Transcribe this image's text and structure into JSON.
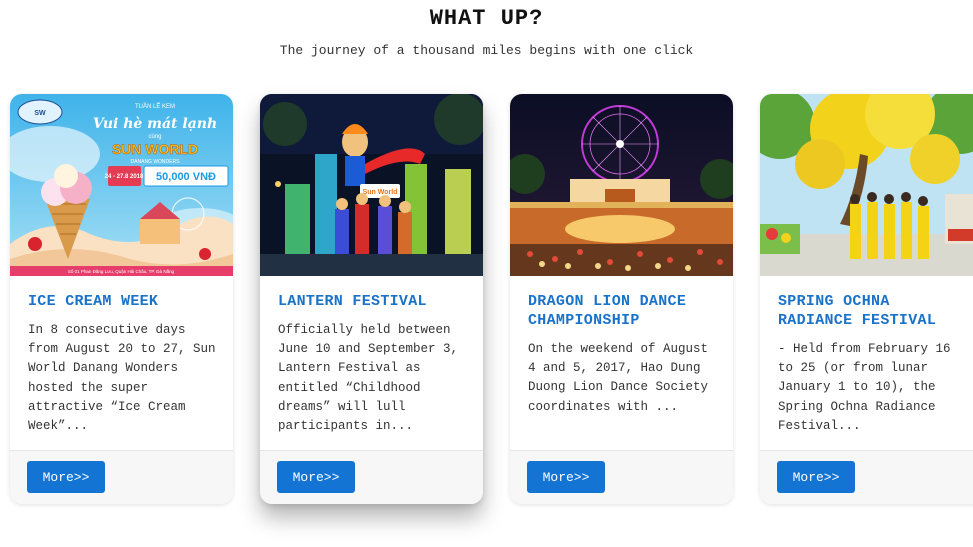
{
  "header": {
    "title": "WHAT UP?",
    "subtitle": "The journey of a thousand miles begins with one click"
  },
  "cards": [
    {
      "title": "ICE CREAM WEEK",
      "text": "In 8 consecutive days from August 20 to 27, Sun World Danang Wonders hosted the super attractive “Ice Cream Week”...",
      "button": "More>>",
      "image": {
        "subtitle": "TUẦN LỄ KEM",
        "headline": "Vui hè mát lạnh",
        "subline": "cùng",
        "brand": "SUN WORLD",
        "brand_sub": "DANANG WONDERS",
        "dates": "24 - 27.8 2018",
        "price": "50,000 VNĐ",
        "address": "Số 01 Phan Đăng Lưu, Quận Hải Châu, TP. Đà Nẵng"
      }
    },
    {
      "title": "LANTERN FESTIVAL",
      "text": "Officially held between June 10 and September 3, Lantern Festival as entitled “Childhood dreams” will lull participants in...",
      "button": "More>>",
      "image": {
        "sign": "Sun World"
      }
    },
    {
      "title": "DRAGON LION DANCE CHAMPIONSHIP",
      "text": "On the weekend of August 4 and 5, 2017, Hao Dung Duong Lion Dance Society coordinates with ...",
      "button": "More>>"
    },
    {
      "title": "SPRING OCHNA RADIANCE FESTIVAL",
      "text": "- Held from February 16 to 25 (or from lunar January 1 to 10), the Spring Ochna Radiance Festival...",
      "button": "More>>"
    }
  ],
  "colors": {
    "title_blue": "#1a73c9",
    "button_blue": "#1474d4",
    "footer_gray": "#f7f7f7"
  }
}
